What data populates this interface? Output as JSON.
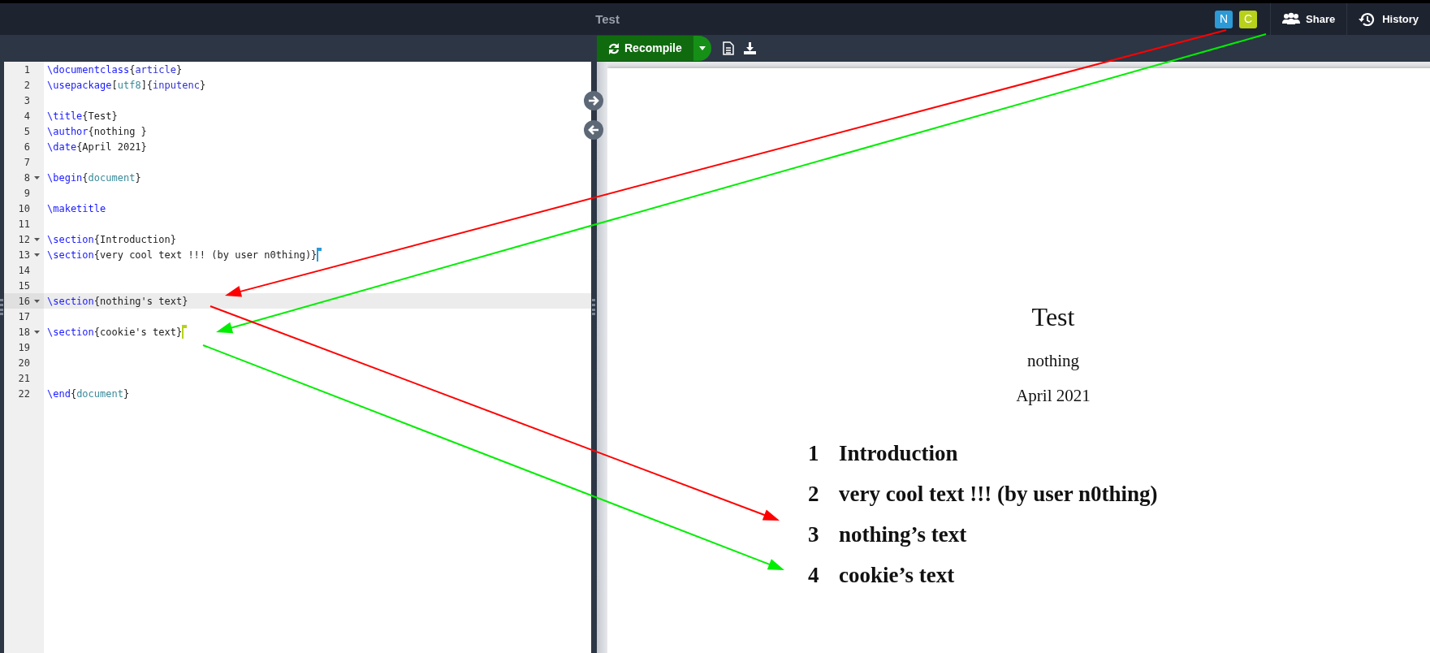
{
  "top_bar": {
    "title": "Test",
    "collaborators": [
      {
        "initial": "N",
        "color": "#2b9ad6"
      },
      {
        "initial": "C",
        "color": "#b8d11a"
      }
    ],
    "buttons": [
      {
        "kind": "share",
        "label": "Share"
      },
      {
        "kind": "history",
        "label": "History"
      }
    ]
  },
  "toolbar": {
    "recompile": "Recompile"
  },
  "editor": {
    "lines": [
      {
        "number": "1",
        "foldable": false,
        "active": false,
        "tokens": [
          {
            "kind": "cmd",
            "text": "\\documentclass"
          },
          {
            "kind": "text",
            "text": "{"
          },
          {
            "kind": "arg",
            "text": "article"
          },
          {
            "kind": "text",
            "text": "}"
          }
        ]
      },
      {
        "number": "2",
        "foldable": false,
        "active": false,
        "tokens": [
          {
            "kind": "cmd",
            "text": "\\usepackage"
          },
          {
            "kind": "text",
            "text": "["
          },
          {
            "kind": "opt",
            "text": "utf8"
          },
          {
            "kind": "text",
            "text": "]{"
          },
          {
            "kind": "arg",
            "text": "inputenc"
          },
          {
            "kind": "text",
            "text": "}"
          }
        ]
      },
      {
        "number": "3",
        "foldable": false,
        "active": false
      },
      {
        "number": "4",
        "foldable": false,
        "active": false,
        "tokens": [
          {
            "kind": "cmd",
            "text": "\\title"
          },
          {
            "kind": "text",
            "text": "{Test}"
          }
        ]
      },
      {
        "number": "5",
        "foldable": false,
        "active": false,
        "tokens": [
          {
            "kind": "cmd",
            "text": "\\author"
          },
          {
            "kind": "text",
            "text": "{nothing }"
          }
        ]
      },
      {
        "number": "6",
        "foldable": false,
        "active": false,
        "tokens": [
          {
            "kind": "cmd",
            "text": "\\date"
          },
          {
            "kind": "text",
            "text": "{April 2021}"
          }
        ]
      },
      {
        "number": "7",
        "foldable": false,
        "active": false
      },
      {
        "number": "8",
        "foldable": true,
        "active": false,
        "tokens": [
          {
            "kind": "cmd",
            "text": "\\begin"
          },
          {
            "kind": "text",
            "text": "{"
          },
          {
            "kind": "opt",
            "text": "document"
          },
          {
            "kind": "text",
            "text": "}"
          }
        ]
      },
      {
        "number": "9",
        "foldable": false,
        "active": false
      },
      {
        "number": "10",
        "foldable": false,
        "active": false,
        "tokens": [
          {
            "kind": "cmd",
            "text": "\\maketitle"
          }
        ]
      },
      {
        "number": "11",
        "foldable": false,
        "active": false
      },
      {
        "number": "12",
        "foldable": true,
        "active": false,
        "tokens": [
          {
            "kind": "cmd",
            "text": "\\section"
          },
          {
            "kind": "text",
            "text": "{Introduction}"
          }
        ]
      },
      {
        "number": "13",
        "foldable": true,
        "active": false,
        "cursor": {
          "color": "#2b9ad6"
        },
        "tokens": [
          {
            "kind": "cmd",
            "text": "\\section"
          },
          {
            "kind": "text",
            "text": "{very cool text !!! (by user n0thing)}"
          }
        ]
      },
      {
        "number": "14",
        "foldable": false,
        "active": false
      },
      {
        "number": "15",
        "foldable": false,
        "active": false
      },
      {
        "number": "16",
        "foldable": true,
        "active": true,
        "tokens": [
          {
            "kind": "cmd",
            "text": "\\section"
          },
          {
            "kind": "text",
            "text": "{nothing's text}"
          }
        ]
      },
      {
        "number": "17",
        "foldable": false,
        "active": false
      },
      {
        "number": "18",
        "foldable": true,
        "active": false,
        "cursor": {
          "color": "#b8d11a"
        },
        "tokens": [
          {
            "kind": "cmd",
            "text": "\\section"
          },
          {
            "kind": "text",
            "text": "{cookie's text}"
          }
        ]
      },
      {
        "number": "19",
        "foldable": false,
        "active": false
      },
      {
        "number": "20",
        "foldable": false,
        "active": false
      },
      {
        "number": "21",
        "foldable": false,
        "active": false
      },
      {
        "number": "22",
        "foldable": false,
        "active": false,
        "tokens": [
          {
            "kind": "cmd",
            "text": "\\end"
          },
          {
            "kind": "text",
            "text": "{"
          },
          {
            "kind": "opt",
            "text": "document"
          },
          {
            "kind": "text",
            "text": "}"
          }
        ]
      }
    ]
  },
  "preview": {
    "title": "Test",
    "author": "nothing",
    "date": "April 2021",
    "sections": [
      {
        "number": "1",
        "title": "Introduction"
      },
      {
        "number": "2",
        "title": "very cool text !!! (by user n0thing)"
      },
      {
        "number": "3",
        "title": "nothing’s text"
      },
      {
        "number": "4",
        "title": "cookie’s text"
      }
    ]
  },
  "annotations": [
    {
      "color": "#ff0000"
    },
    {
      "color": "#00ee00"
    },
    {
      "color": "#ff0000"
    },
    {
      "color": "#00ee00"
    }
  ]
}
